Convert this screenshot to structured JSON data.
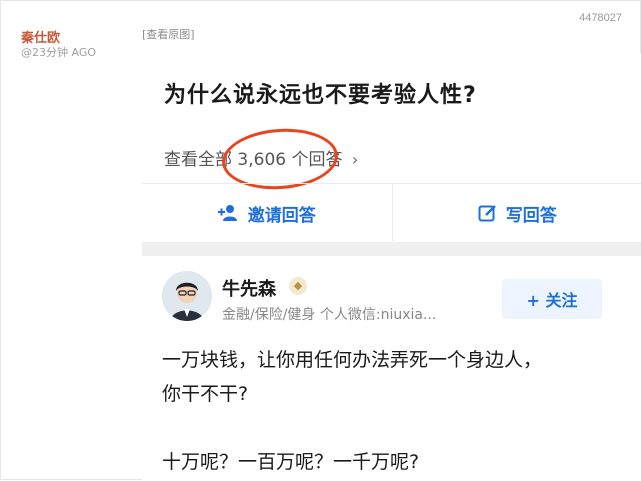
{
  "post": {
    "id": "4478027",
    "author": "秦仕欧",
    "time": "@23分钟 AGO",
    "view_original": "[查看原图]"
  },
  "screenshot": {
    "question_title": "为什么说永远也不要考验人性?",
    "view_all_prefix": "查看全部",
    "answer_count": "3,606",
    "view_all_suffix": "个回答",
    "invite_label": "邀请回答",
    "write_label": "写回答",
    "answerer_name": "牛先森",
    "answerer_bio": "金融/保险/健身 个人微信:niuxia...",
    "follow_label": "+ 关注",
    "body_lines": [
      "一万块钱，让你用任何办法弄死一个身边人，",
      "你干不干?",
      "十万呢？一百万呢？一千万呢?"
    ]
  },
  "colors": {
    "author": "#c8573a",
    "link_blue": "#1e6fd9",
    "highlight_circle": "#e8451e"
  },
  "icons": {
    "invite": "add-user-icon",
    "write": "edit-icon",
    "badge": "verified-badge-icon",
    "chevron": "chevron-right-icon"
  }
}
